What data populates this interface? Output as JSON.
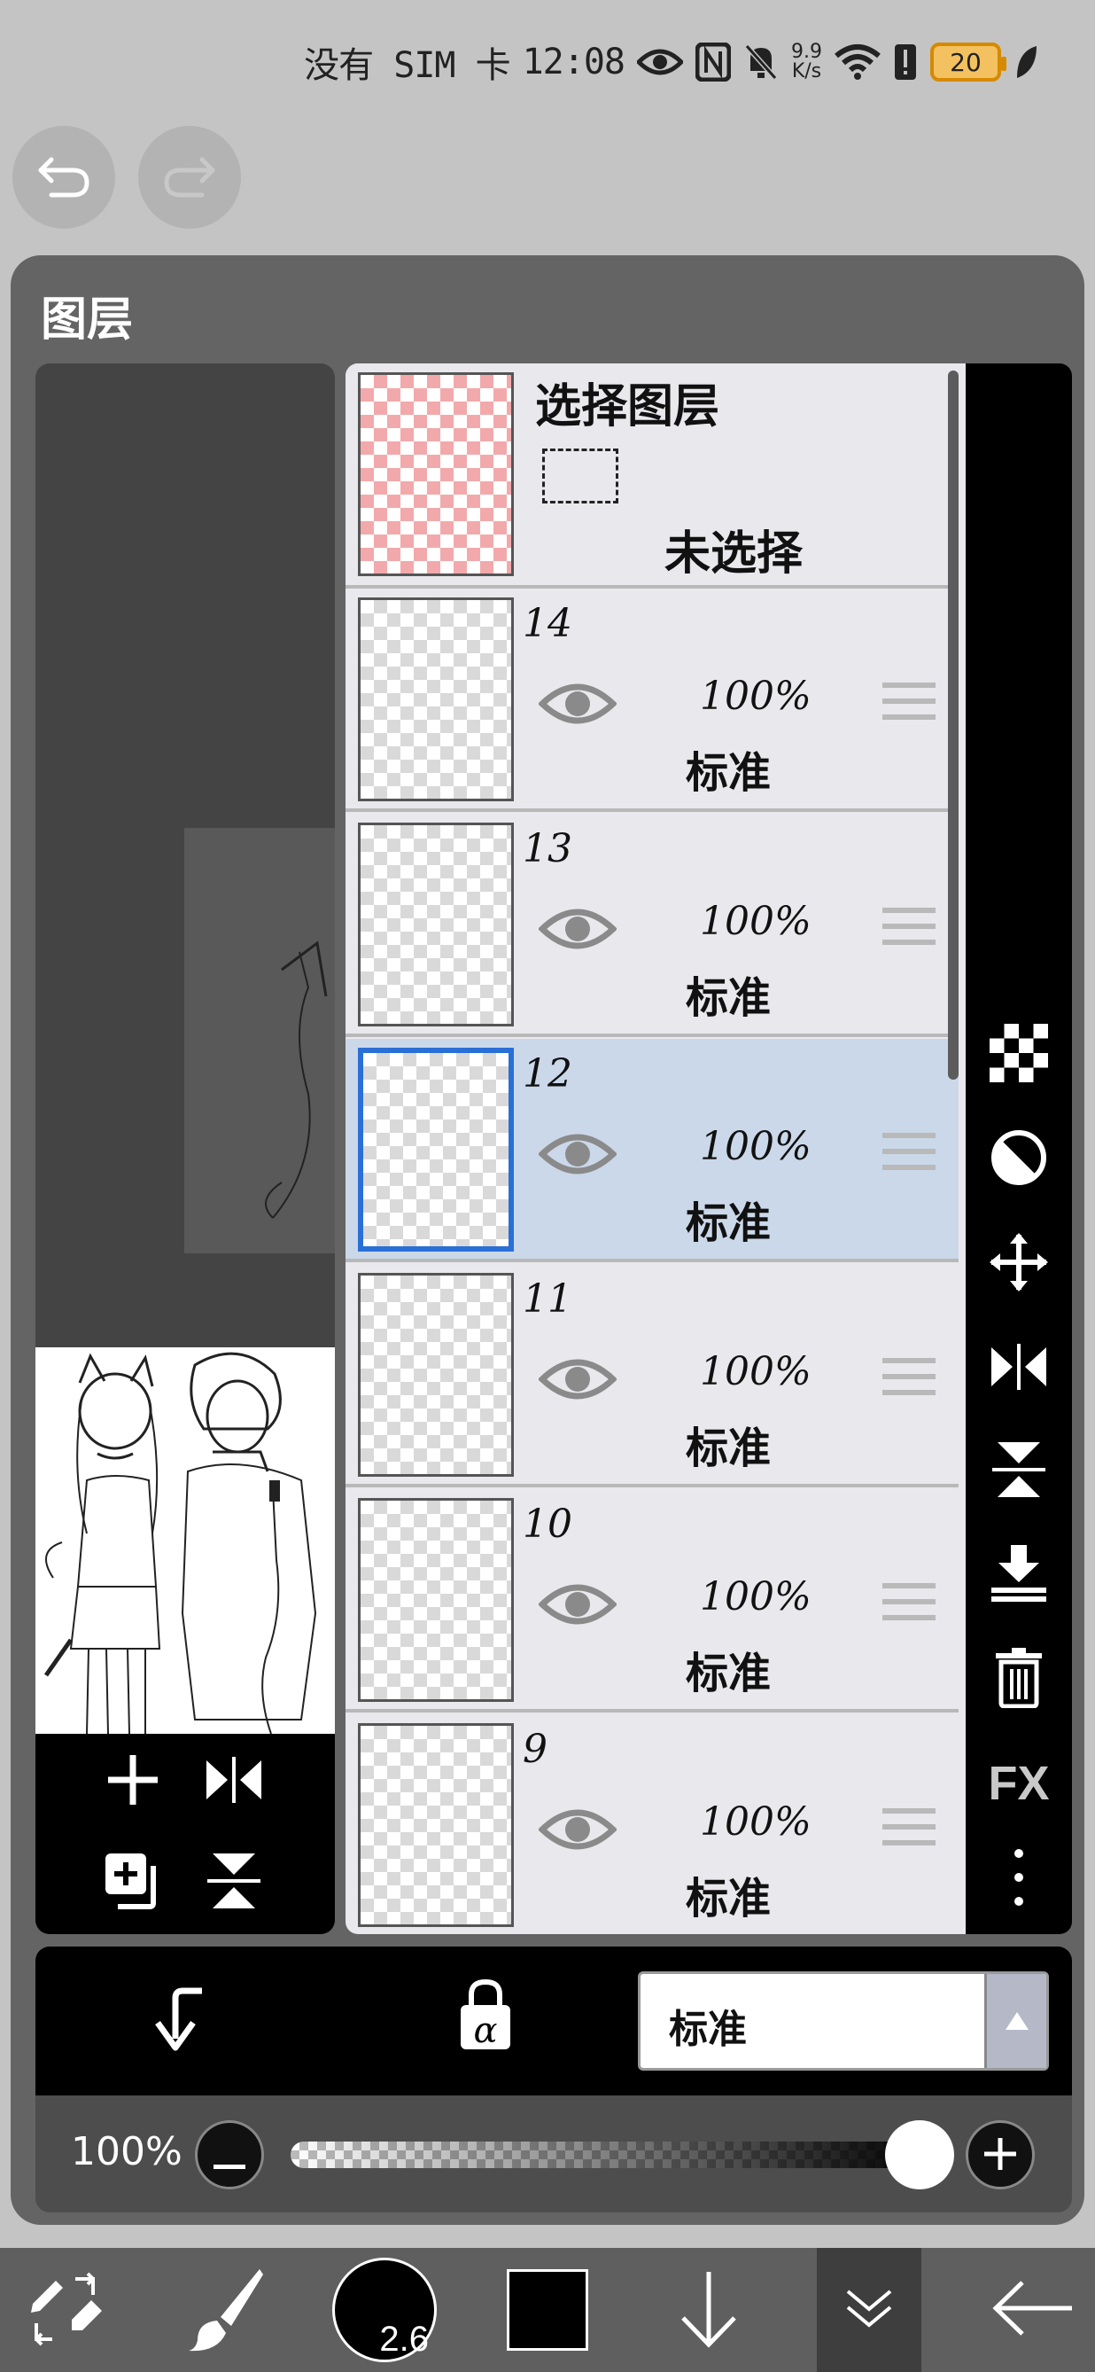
{
  "status_bar": {
    "carrier": "没有 SIM 卡",
    "time": "12:08",
    "speed_value": "9.9",
    "speed_unit": "K/s",
    "battery": "20"
  },
  "panel": {
    "title": "图层"
  },
  "selection_layer": {
    "title": "选择图层",
    "state": "未选择"
  },
  "layers": [
    {
      "name": "14",
      "opacity": "100%",
      "blend": "标准",
      "selected": false
    },
    {
      "name": "13",
      "opacity": "100%",
      "blend": "标准",
      "selected": false
    },
    {
      "name": "12",
      "opacity": "100%",
      "blend": "标准",
      "selected": true
    },
    {
      "name": "11",
      "opacity": "100%",
      "blend": "标准",
      "selected": false
    },
    {
      "name": "10",
      "opacity": "100%",
      "blend": "标准",
      "selected": false
    },
    {
      "name": "9",
      "opacity": "100%",
      "blend": "标准",
      "selected": false
    }
  ],
  "side_tools": {
    "fx_label": "FX"
  },
  "blend_mode": {
    "value": "标准"
  },
  "opacity_control": {
    "label": "100%",
    "value": 1.0
  },
  "brush": {
    "size": "2.6"
  },
  "colors": {
    "selected_highlight": "#cbd8ea",
    "selected_border": "#2a6fd6",
    "selection_checker": "#f2a9ab",
    "primary_color": "#000000"
  }
}
